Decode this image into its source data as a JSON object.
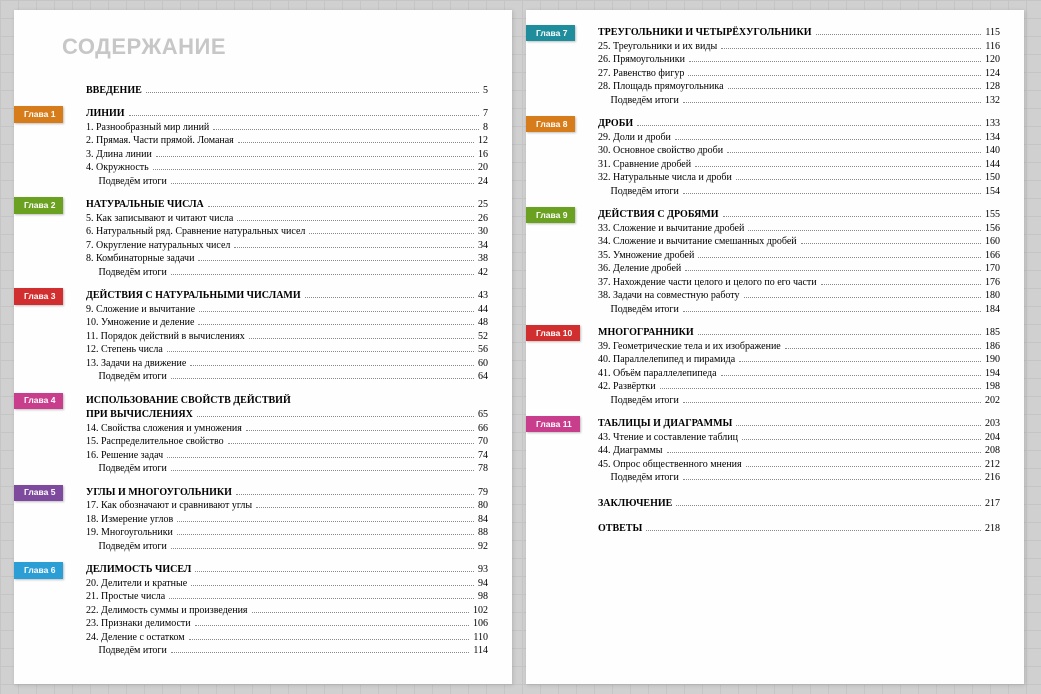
{
  "title": "СОДЕРЖАНИЕ",
  "intro": {
    "label": "ВВЕДЕНИЕ",
    "page": 5
  },
  "chapters": [
    {
      "tab": "Глава 1",
      "color": "#d67c1a",
      "title": "ЛИНИИ",
      "title_page": 7,
      "items": [
        {
          "n": 1,
          "t": "Разнообразный мир линий",
          "p": 8
        },
        {
          "n": 2,
          "t": "Прямая. Части прямой. Ломаная",
          "p": 12
        },
        {
          "n": 3,
          "t": "Длина линии",
          "p": 16
        },
        {
          "n": 4,
          "t": "Окружность",
          "p": 20
        }
      ],
      "summary_p": 24
    },
    {
      "tab": "Глава 2",
      "color": "#6aa121",
      "title": "НАТУРАЛЬНЫЕ ЧИСЛА",
      "title_page": 25,
      "items": [
        {
          "n": 5,
          "t": "Как записывают и читают числа",
          "p": 26
        },
        {
          "n": 6,
          "t": "Натуральный ряд. Сравнение натуральных чисел",
          "p": 30
        },
        {
          "n": 7,
          "t": "Округление натуральных чисел",
          "p": 34
        },
        {
          "n": 8,
          "t": "Комбинаторные задачи",
          "p": 38
        }
      ],
      "summary_p": 42
    },
    {
      "tab": "Глава 3",
      "color": "#d12f2f",
      "title": "ДЕЙСТВИЯ С НАТУРАЛЬНЫМИ ЧИСЛАМИ",
      "title_page": 43,
      "items": [
        {
          "n": 9,
          "t": "Сложение и вычитание",
          "p": 44
        },
        {
          "n": 10,
          "t": "Умножение и деление",
          "p": 48
        },
        {
          "n": 11,
          "t": "Порядок действий в вычислениях",
          "p": 52
        },
        {
          "n": 12,
          "t": "Степень числа",
          "p": 56
        },
        {
          "n": 13,
          "t": "Задачи на движение",
          "p": 60
        }
      ],
      "summary_p": 64
    },
    {
      "tab": "Глава 4",
      "color": "#c83d8c",
      "title": "ИСПОЛЬЗОВАНИЕ СВОЙСТВ ДЕЙСТВИЙ",
      "title2": "ПРИ ВЫЧИСЛЕНИЯХ",
      "title_page": 65,
      "items": [
        {
          "n": 14,
          "t": "Свойства сложения и умножения",
          "p": 66
        },
        {
          "n": 15,
          "t": "Распределительное свойство",
          "p": 70
        },
        {
          "n": 16,
          "t": "Решение задач",
          "p": 74
        }
      ],
      "summary_p": 78
    },
    {
      "tab": "Глава 5",
      "color": "#7e4a9e",
      "title": "УГЛЫ И МНОГОУГОЛЬНИКИ",
      "title_page": 79,
      "items": [
        {
          "n": 17,
          "t": "Как обозначают и сравнивают углы",
          "p": 80
        },
        {
          "n": 18,
          "t": "Измерение углов",
          "p": 84
        },
        {
          "n": 19,
          "t": "Многоугольники",
          "p": 88
        }
      ],
      "summary_p": 92
    },
    {
      "tab": "Глава 6",
      "color": "#2c9ed6",
      "title": "ДЕЛИМОСТЬ ЧИСЕЛ",
      "title_page": 93,
      "items": [
        {
          "n": 20,
          "t": "Делители и кратные",
          "p": 94
        },
        {
          "n": 21,
          "t": "Простые числа",
          "p": 98
        },
        {
          "n": 22,
          "t": "Делимость суммы и произведения",
          "p": 102
        },
        {
          "n": 23,
          "t": "Признаки делимости",
          "p": 106
        },
        {
          "n": 24,
          "t": "Деление с остатком",
          "p": 110
        }
      ],
      "summary_p": 114
    },
    {
      "tab": "Глава 7",
      "color": "#1f8d9b",
      "title": "ТРЕУГОЛЬНИКИ И ЧЕТЫРЁХУГОЛЬНИКИ",
      "title_page": 115,
      "items": [
        {
          "n": 25,
          "t": "Треугольники и их виды",
          "p": 116
        },
        {
          "n": 26,
          "t": "Прямоугольники",
          "p": 120
        },
        {
          "n": 27,
          "t": "Равенство фигур",
          "p": 124
        },
        {
          "n": 28,
          "t": "Площадь прямоугольника",
          "p": 128
        }
      ],
      "summary_p": 132
    },
    {
      "tab": "Глава 8",
      "color": "#d67c1a",
      "title": "ДРОБИ",
      "title_page": 133,
      "items": [
        {
          "n": 29,
          "t": "Доли и дроби",
          "p": 134
        },
        {
          "n": 30,
          "t": "Основное свойство дроби",
          "p": 140
        },
        {
          "n": 31,
          "t": "Сравнение дробей",
          "p": 144
        },
        {
          "n": 32,
          "t": "Натуральные числа и дроби",
          "p": 150
        }
      ],
      "summary_p": 154
    },
    {
      "tab": "Глава 9",
      "color": "#6aa121",
      "title": "ДЕЙСТВИЯ С ДРОБЯМИ",
      "title_page": 155,
      "items": [
        {
          "n": 33,
          "t": "Сложение и вычитание дробей",
          "p": 156
        },
        {
          "n": 34,
          "t": "Сложение и вычитание смешанных дробей",
          "p": 160
        },
        {
          "n": 35,
          "t": "Умножение дробей",
          "p": 166
        },
        {
          "n": 36,
          "t": "Деление дробей",
          "p": 170
        },
        {
          "n": 37,
          "t": "Нахождение части целого и целого по его части",
          "p": 176
        },
        {
          "n": 38,
          "t": "Задачи на совместную работу",
          "p": 180
        }
      ],
      "summary_p": 184
    },
    {
      "tab": "Глава 10",
      "color": "#d12f2f",
      "title": "МНОГОГРАННИКИ",
      "title_page": 185,
      "items": [
        {
          "n": 39,
          "t": "Геометрические тела и их изображение",
          "p": 186
        },
        {
          "n": 40,
          "t": "Параллелепипед и пирамида",
          "p": 190
        },
        {
          "n": 41,
          "t": "Объём параллелепипеда",
          "p": 194
        },
        {
          "n": 42,
          "t": "Развёртки",
          "p": 198
        }
      ],
      "summary_p": 202
    },
    {
      "tab": "Глава 11",
      "color": "#c83d8c",
      "title": "ТАБЛИЦЫ И ДИАГРАММЫ",
      "title_page": 203,
      "items": [
        {
          "n": 43,
          "t": "Чтение и составление таблиц",
          "p": 204
        },
        {
          "n": 44,
          "t": "Диаграммы",
          "p": 208
        },
        {
          "n": 45,
          "t": "Опрос общественного мнения",
          "p": 212
        }
      ],
      "summary_p": 216
    }
  ],
  "conclusion": {
    "label": "ЗАКЛЮЧЕНИЕ",
    "page": 217
  },
  "answers": {
    "label": "ОТВЕТЫ",
    "page": 218
  },
  "summary_label": "Подведём итоги"
}
